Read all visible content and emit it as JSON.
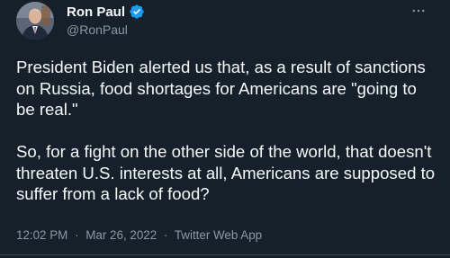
{
  "author": {
    "name": "Ron Paul",
    "handle": "@RonPaul",
    "verified": true
  },
  "tweet": {
    "paragraphs": [
      "President Biden alerted us that, as a result of sanctions on Russia, food shortages for Americans are \"going to be real.\"",
      "So, for a fight on the other side of the world, that doesn't threaten U.S. interests at all, Americans are supposed to suffer from a lack of food?"
    ]
  },
  "meta": {
    "time": "12:02 PM",
    "date": "Mar 26, 2022",
    "source": "Twitter Web App",
    "separator": "·"
  },
  "icons": {
    "verified": "verified-badge-icon",
    "more": "more-options-icon"
  },
  "colors": {
    "background": "#15202b",
    "text_primary": "#f7f9f9",
    "text_secondary": "#8b98a5",
    "verified_badge": "#1d9bf0"
  }
}
